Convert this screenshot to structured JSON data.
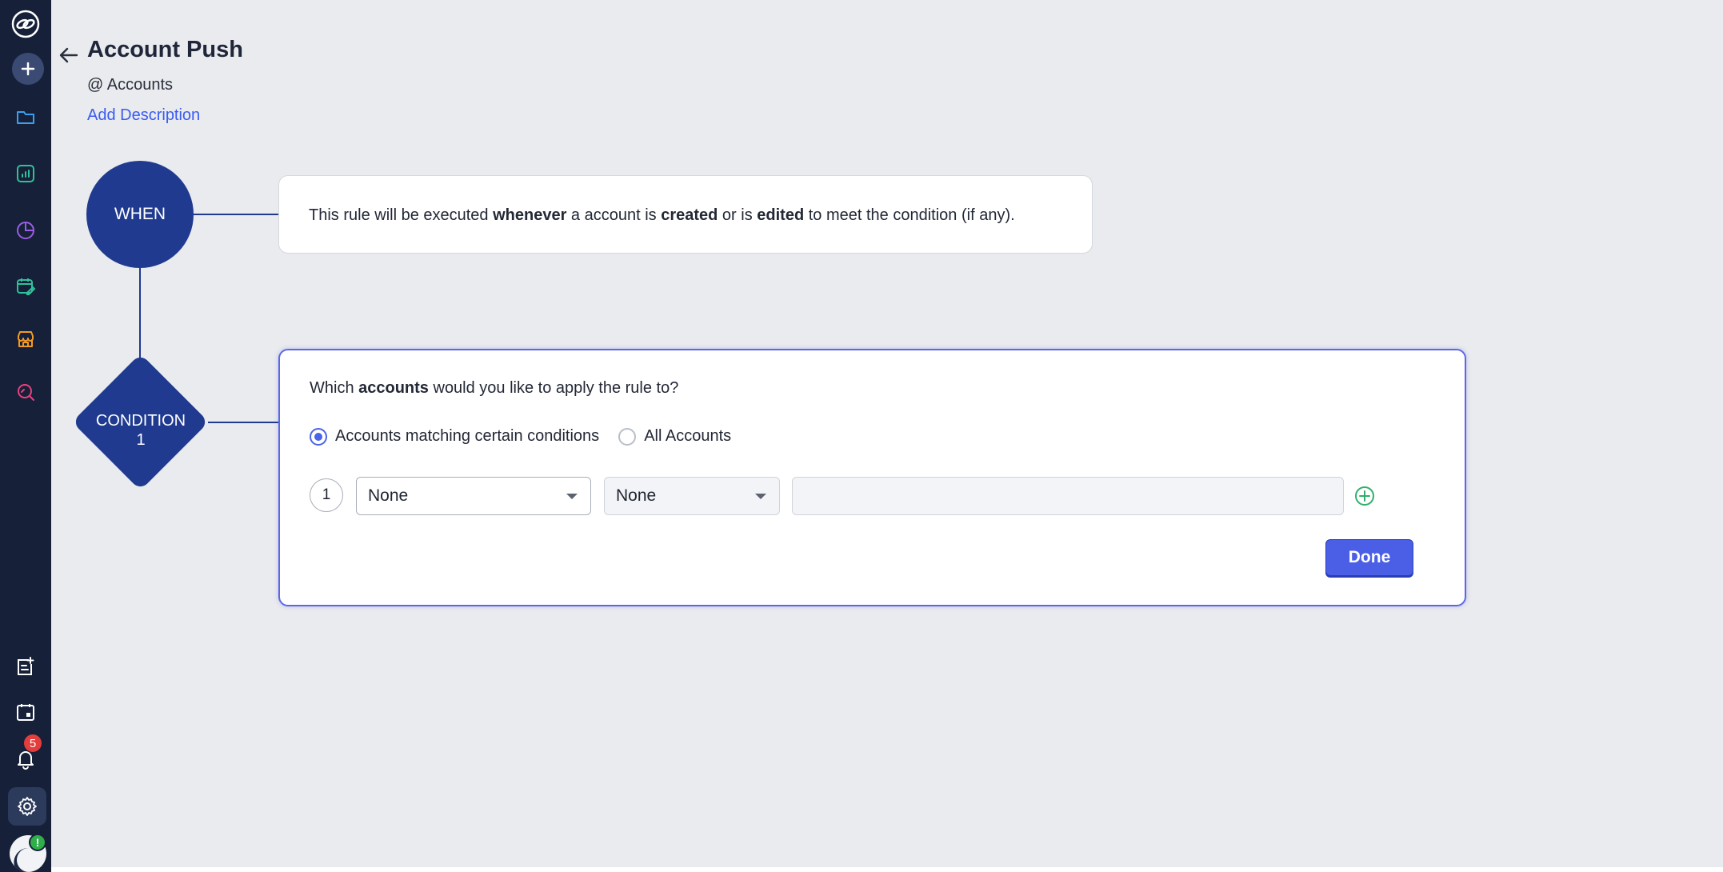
{
  "page": {
    "title": "Account Push",
    "module": "@ Accounts",
    "add_description": "Add Description"
  },
  "sidebar": {
    "icons": [
      "zoho-logo-icon",
      "plus-icon",
      "folder-icon",
      "report-icon",
      "analytics-icon",
      "calendar-edit-icon",
      "store-icon",
      "search-icon",
      "notes-add-icon",
      "calendar-icon",
      "bell-icon",
      "gear-icon"
    ],
    "notification_count": "5"
  },
  "flow": {
    "when_label": "WHEN",
    "condition_label_line1": "CONDITION",
    "condition_label_line2": "1"
  },
  "when_card": {
    "t1": "This rule will be executed ",
    "b1": "whenever",
    "t2": " a account is ",
    "b2": "created",
    "t3": " or is ",
    "b3": "edited",
    "t4": " to meet the condition (if any)."
  },
  "condition_card": {
    "q1": "Which ",
    "q_bold": "accounts",
    "q2": " would you like to apply the rule to?",
    "radio_1": "Accounts matching certain conditions",
    "radio_2": "All Accounts",
    "selected_radio": "radio_1",
    "row_number": "1",
    "field_select": "None",
    "operator_select": "None",
    "value_input": "",
    "done_label": "Done"
  },
  "colors": {
    "accent": "#4a5fe6",
    "node": "#1f3a8f",
    "sidebar": "#162038",
    "link": "#3a5bf0"
  }
}
